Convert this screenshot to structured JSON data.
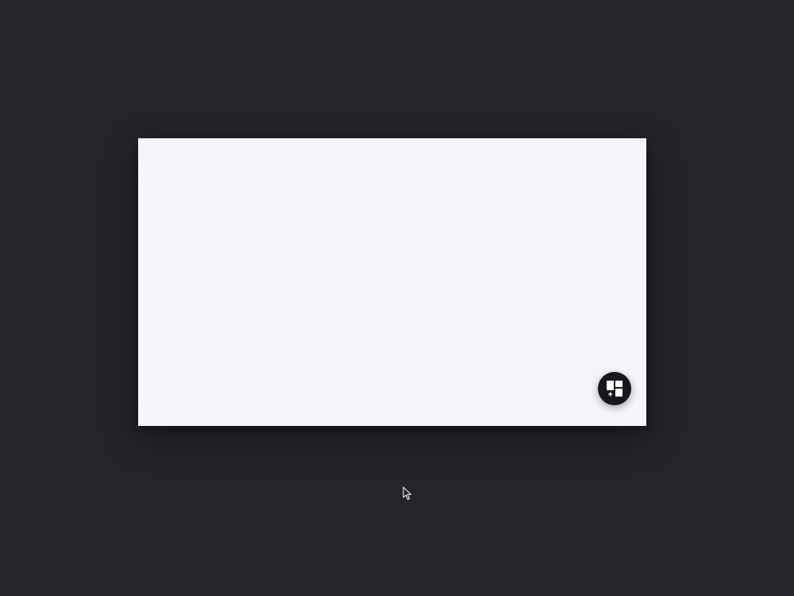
{
  "stage": {
    "background_color": "#24252a"
  },
  "canvas": {
    "background_color": "#f4f6fa"
  },
  "fab": {
    "icon": "add-widget-icon",
    "background_color": "#17181c",
    "icon_color": "#ffffff"
  },
  "cursor": {
    "icon": "mouse-pointer-icon"
  }
}
